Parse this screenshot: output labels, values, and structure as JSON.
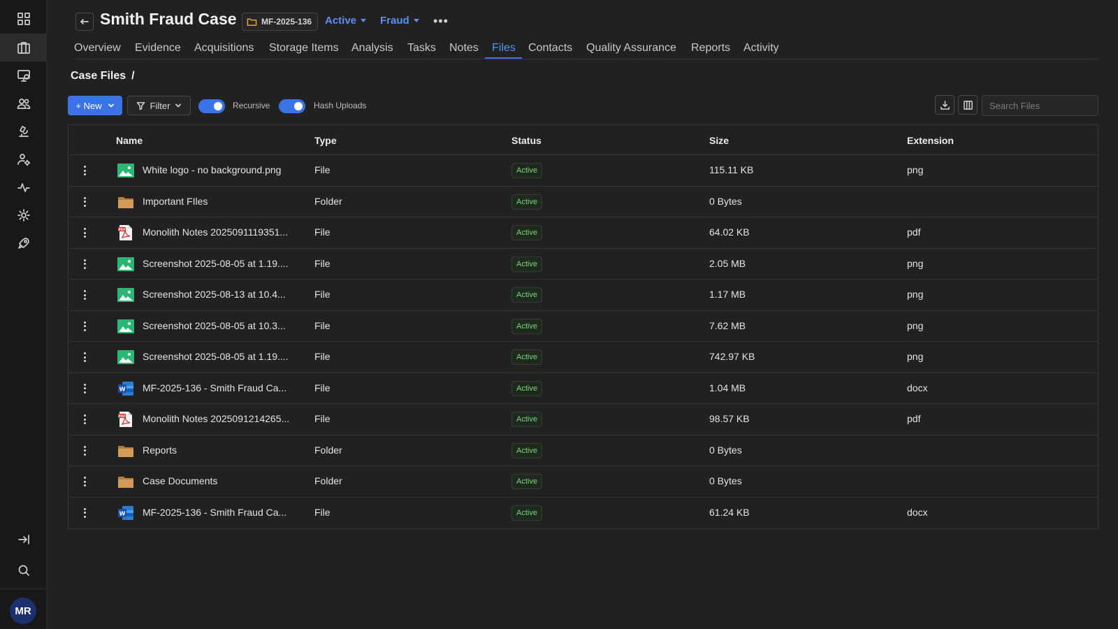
{
  "sidebar": {
    "items": [
      {
        "icon": "dashboard-grid-icon"
      },
      {
        "icon": "cases-icon"
      },
      {
        "icon": "evidence-monitor-icon"
      },
      {
        "icon": "contacts-people-icon"
      },
      {
        "icon": "lab-microscope-icon"
      },
      {
        "icon": "user-settings-icon"
      },
      {
        "icon": "activity-pulse-icon"
      },
      {
        "icon": "settings-gear-icon"
      },
      {
        "icon": "rocket-icon"
      }
    ],
    "active_index": 1,
    "avatar_initials": "MR"
  },
  "header": {
    "title": "Smith Fraud Case",
    "case_number": "MF-2025-136",
    "status": "Active",
    "type": "Fraud"
  },
  "tabs": [
    {
      "label": "Overview"
    },
    {
      "label": "Evidence"
    },
    {
      "label": "Acquisitions"
    },
    {
      "label": "Storage Items"
    },
    {
      "label": "Analysis"
    },
    {
      "label": "Tasks"
    },
    {
      "label": "Notes"
    },
    {
      "label": "Files",
      "active": true
    },
    {
      "label": "Contacts"
    },
    {
      "label": "Quality Assurance"
    },
    {
      "label": "Reports"
    },
    {
      "label": "Activity"
    }
  ],
  "breadcrumb": {
    "root": "Case Files",
    "separator": "/"
  },
  "toolbar": {
    "new_label": "+ New",
    "filter_label": "Filter",
    "recursive_label": "Recursive",
    "recursive_on": true,
    "hash_label": "Hash Uploads",
    "hash_on": true,
    "search_placeholder": "Search Files"
  },
  "table": {
    "columns": [
      "Name",
      "Type",
      "Status",
      "Size",
      "Extension"
    ],
    "rows": [
      {
        "icon": "image",
        "name": "White logo - no background.png",
        "type": "File",
        "status": "Active",
        "size": "115.11 KB",
        "ext": "png"
      },
      {
        "icon": "folder",
        "name": "Important FIles",
        "type": "Folder",
        "status": "Active",
        "size": "0 Bytes",
        "ext": ""
      },
      {
        "icon": "pdf",
        "name": "Monolith Notes 2025091119351...",
        "type": "File",
        "status": "Active",
        "size": "64.02 KB",
        "ext": "pdf"
      },
      {
        "icon": "image",
        "name": "Screenshot 2025-08-05 at 1.19....",
        "type": "File",
        "status": "Active",
        "size": "2.05 MB",
        "ext": "png"
      },
      {
        "icon": "image",
        "name": "Screenshot 2025-08-13 at 10.4...",
        "type": "File",
        "status": "Active",
        "size": "1.17 MB",
        "ext": "png"
      },
      {
        "icon": "image",
        "name": "Screenshot 2025-08-05 at 10.3...",
        "type": "File",
        "status": "Active",
        "size": "7.62 MB",
        "ext": "png"
      },
      {
        "icon": "image",
        "name": "Screenshot 2025-08-05 at 1.19....",
        "type": "File",
        "status": "Active",
        "size": "742.97 KB",
        "ext": "png"
      },
      {
        "icon": "word",
        "name": "MF-2025-136 - Smith Fraud Ca...",
        "type": "File",
        "status": "Active",
        "size": "1.04 MB",
        "ext": "docx"
      },
      {
        "icon": "pdf",
        "name": "Monolith Notes 2025091214265...",
        "type": "File",
        "status": "Active",
        "size": "98.57 KB",
        "ext": "pdf"
      },
      {
        "icon": "folder",
        "name": "Reports",
        "type": "Folder",
        "status": "Active",
        "size": "0 Bytes",
        "ext": ""
      },
      {
        "icon": "folder",
        "name": "Case Documents",
        "type": "Folder",
        "status": "Active",
        "size": "0 Bytes",
        "ext": ""
      },
      {
        "icon": "word",
        "name": "MF-2025-136 - Smith Fraud Ca...",
        "type": "File",
        "status": "Active",
        "size": "61.24 KB",
        "ext": "docx"
      }
    ]
  },
  "colors": {
    "accent": "#3b73e6",
    "link": "#5b8ff0",
    "status_active": "#7ed37e",
    "folder": "#c8914a",
    "image": "#2bb673"
  }
}
